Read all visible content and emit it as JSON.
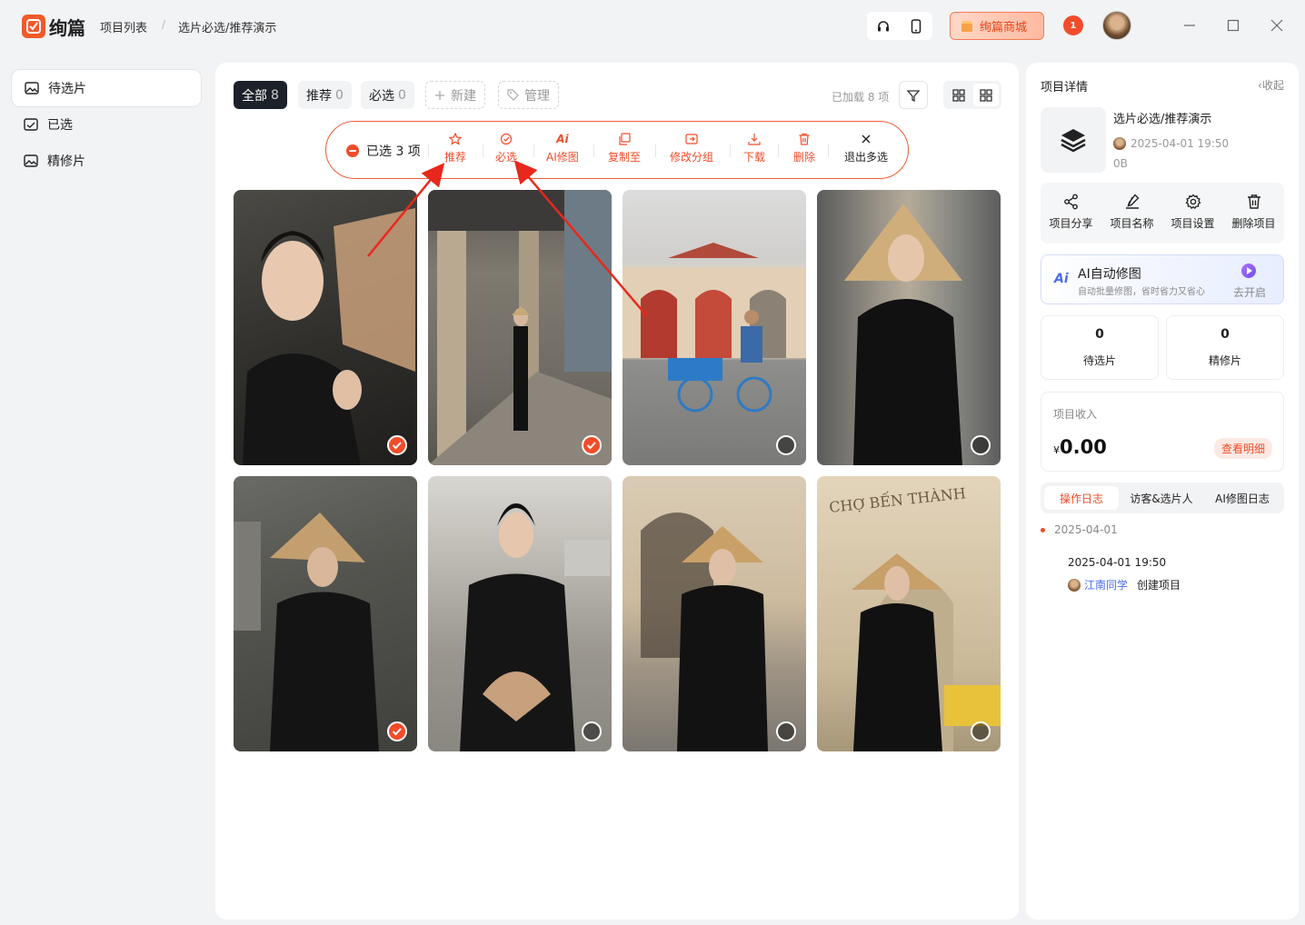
{
  "app": {
    "name": "绚篇",
    "breadcrumb": [
      "项目列表",
      "选片必选/推荐演示"
    ],
    "store_label": "绚篇商城",
    "notification_badge": "1"
  },
  "sidebar": {
    "items": [
      {
        "label": "待选片",
        "active": true
      },
      {
        "label": "已选",
        "active": false
      },
      {
        "label": "精修片",
        "active": false
      }
    ]
  },
  "main": {
    "tabs": [
      {
        "label": "全部",
        "count": "8",
        "active": true
      },
      {
        "label": "推荐",
        "count": "0",
        "active": false
      },
      {
        "label": "必选",
        "count": "0",
        "active": false
      }
    ],
    "new_label": "新建",
    "manage_label": "管理",
    "loaded_text": "已加载 8 项"
  },
  "selection": {
    "count_text": "已选 3 项",
    "tools": [
      {
        "label": "推荐",
        "icon": "star-icon"
      },
      {
        "label": "必选",
        "icon": "check-circle-icon"
      },
      {
        "label": "AI修图",
        "icon": "ai-icon"
      },
      {
        "label": "复制至",
        "icon": "copy-icon"
      },
      {
        "label": "修改分组",
        "icon": "move-icon"
      },
      {
        "label": "下载",
        "icon": "download-icon"
      },
      {
        "label": "删除",
        "icon": "trash-icon"
      },
      {
        "label": "退出多选",
        "icon": "close-icon"
      }
    ]
  },
  "photos": [
    {
      "scene": "fan portrait",
      "selected": true
    },
    {
      "scene": "arcade walkway",
      "selected": true
    },
    {
      "scene": "cyclo street",
      "selected": false
    },
    {
      "scene": "conical hat portrait",
      "selected": false
    },
    {
      "scene": "hat street",
      "selected": true
    },
    {
      "scene": "fan street",
      "selected": false
    },
    {
      "scene": "hat arch",
      "selected": false
    },
    {
      "scene": "cho ben thanh market",
      "selected": false
    }
  ],
  "panel": {
    "title": "项目详情",
    "collapse_label": "收起",
    "project_name": "选片必选/推荐演示",
    "project_date": "2025-04-01 19:50",
    "project_size": "0B",
    "actions": [
      {
        "label": "项目分享",
        "icon": "share-icon"
      },
      {
        "label": "项目名称",
        "icon": "edit-icon"
      },
      {
        "label": "项目设置",
        "icon": "gear-icon"
      },
      {
        "label": "删除项目",
        "icon": "trash-icon"
      }
    ],
    "ai": {
      "logo": "Ai",
      "title": "AI自动修图",
      "subtitle": "自动批量修图，省时省力又省心",
      "go_label": "去开启"
    },
    "stats": [
      {
        "value": "0",
        "label": "待选片"
      },
      {
        "value": "0",
        "label": "精修片"
      }
    ],
    "income": {
      "label": "项目收入",
      "currency": "¥",
      "amount": "0.00",
      "detail_label": "查看明细"
    },
    "log_tabs": [
      {
        "label": "操作日志",
        "active": true
      },
      {
        "label": "访客&选片人",
        "active": false
      },
      {
        "label": "AI修图日志",
        "active": false
      }
    ],
    "log": {
      "date": "2025-04-01",
      "time": "2025-04-01 19:50",
      "user": "江南同学",
      "action": "创建项目"
    }
  },
  "colors": {
    "accent": "#f24c2a",
    "dark_tab": "#1d2129",
    "link": "#4a6cf0"
  }
}
